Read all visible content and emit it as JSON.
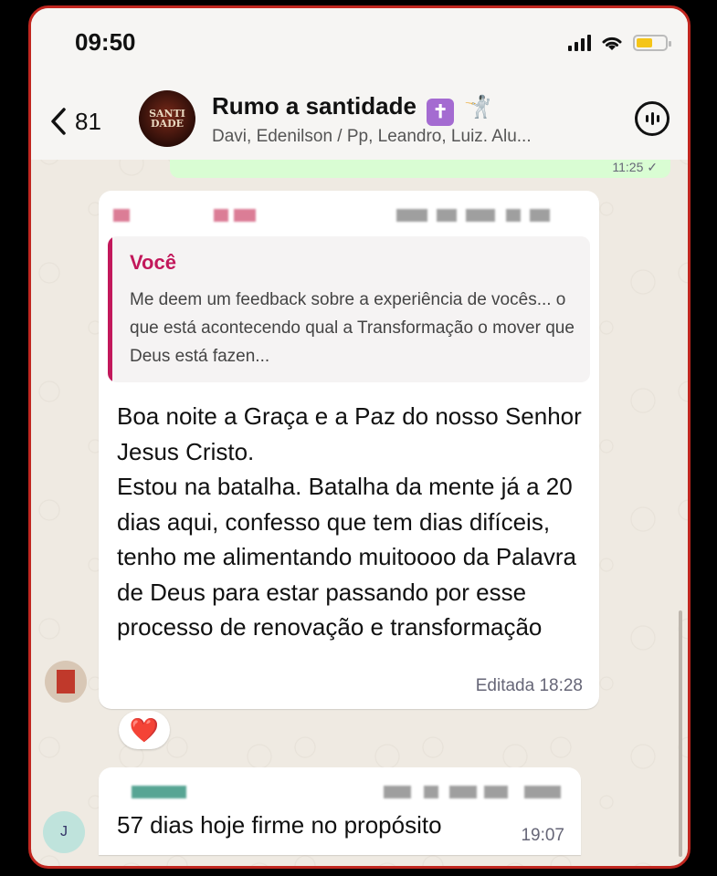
{
  "status_bar": {
    "time": "09:50"
  },
  "header": {
    "back_count": "81",
    "group_avatar_text": "SANTI DADE",
    "group_name": "Rumo a santidade",
    "title_emoji_1": "✝",
    "title_emoji_2": "🤺",
    "members": "Davi, Edenilson / Pp, Leandro, Luiz. Alu..."
  },
  "previous_message": {
    "time": "11:25 ✓"
  },
  "message_1": {
    "quote_author": "Você",
    "quote_text": "Me deem um feedback sobre a experiência de vocês... o que está acontecendo qual a Transformação o mover que Deus está fazen...",
    "text": "Boa noite a Graça e a Paz do nosso Senhor Jesus Cristo.\nEstou na batalha. Batalha da mente já a 20 dias aqui, confesso que tem dias difíceis, tenho me alimentando muitoooo da Palavra de Deus para estar passando por esse processo de renovação e transformação",
    "edited_time": "Editada 18:28",
    "reaction": "❤️"
  },
  "message_2": {
    "avatar_initial": "J",
    "text": "57 dias hoje firme no propósito",
    "time": "19:07"
  },
  "colors": {
    "accent": "#c2185b",
    "outgoing_bubble": "#d9fdd3",
    "frame_border": "#c0261f"
  },
  "icons": [
    "back-chevron-icon",
    "voice-call-icon",
    "signal-icon",
    "wifi-icon",
    "battery-icon",
    "heart-reaction-icon"
  ]
}
